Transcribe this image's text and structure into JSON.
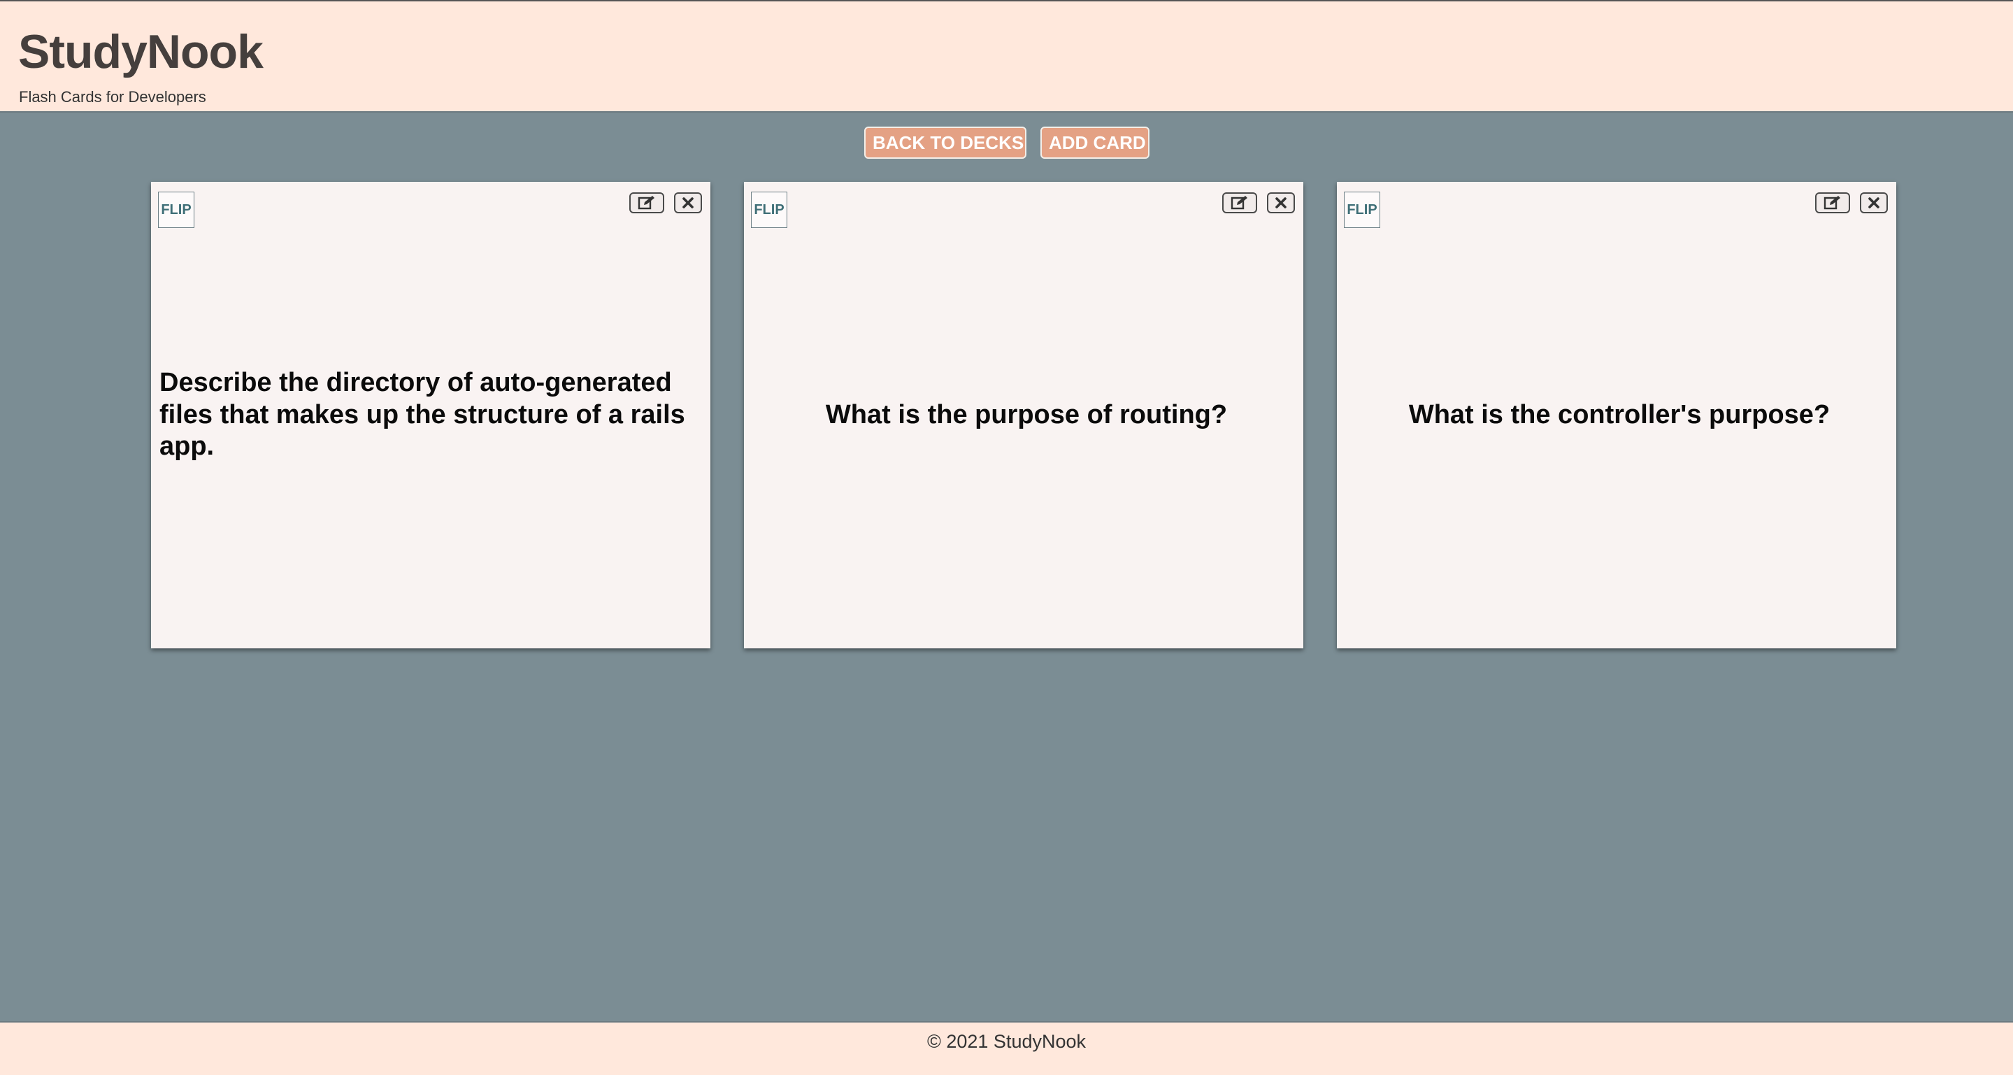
{
  "header": {
    "title": "StudyNook",
    "subtitle": "Flash Cards for Developers"
  },
  "toolbar": {
    "back_label": "BACK TO DECKS",
    "add_label": "ADD CARD"
  },
  "cards": [
    {
      "flip_label": "FLIP",
      "text": "Describe the directory of auto-generated files that makes up the structure of a rails app.",
      "edit_icon": "edit-icon",
      "delete_icon": "close-icon"
    },
    {
      "flip_label": "FLIP",
      "text": "What is the purpose of routing?",
      "edit_icon": "edit-icon",
      "delete_icon": "close-icon"
    },
    {
      "flip_label": "FLIP",
      "text": "What is the controller's purpose?",
      "edit_icon": "edit-icon",
      "delete_icon": "close-icon"
    }
  ],
  "footer": {
    "text": "© 2021 StudyNook"
  },
  "colors": {
    "header_bg": "#ffe8dc",
    "page_bg": "#7b8d94",
    "button_bg": "#e4a184",
    "card_bg": "#f9f3f2",
    "title_color": "#453f3d"
  }
}
